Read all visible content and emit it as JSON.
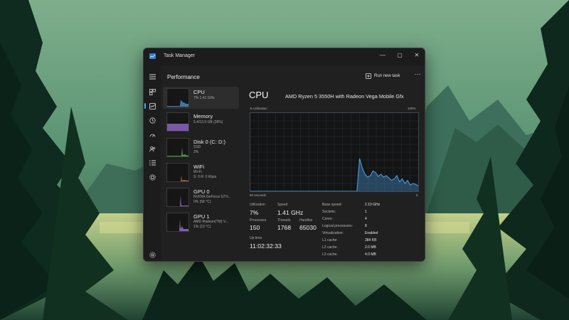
{
  "window": {
    "title": "Task Manager",
    "controls": {
      "minimize": "—",
      "maximize": "▢",
      "close": "✕"
    }
  },
  "nav": {
    "items": [
      {
        "icon": "hamburger-icon"
      },
      {
        "icon": "processes-icon"
      },
      {
        "icon": "performance-icon",
        "active": true
      },
      {
        "icon": "app-history-icon"
      },
      {
        "icon": "startup-apps-icon"
      },
      {
        "icon": "users-icon"
      },
      {
        "icon": "details-icon"
      },
      {
        "icon": "services-icon"
      },
      {
        "icon": "settings-icon"
      }
    ]
  },
  "header": {
    "title": "Performance",
    "run_new_task": "Run new task",
    "more": "···"
  },
  "devices": [
    {
      "name": "CPU",
      "sub1": "7% 1.41 GHz",
      "sub2": "",
      "selected": true,
      "color": "#4ea3e8"
    },
    {
      "name": "Memory",
      "sub1": "5.4/13.9 GB (39%)",
      "sub2": "",
      "selected": false,
      "color": "#9b6fd8"
    },
    {
      "name": "Disk 0 (C: D:)",
      "sub1": "SSD",
      "sub2": "2%",
      "selected": false,
      "color": "#5fbf5f"
    },
    {
      "name": "WiFi",
      "sub1": "Wi-Fi",
      "sub2": "S: 0 R: 0 Kbps",
      "selected": false,
      "color": "#c57b3a"
    },
    {
      "name": "GPU 0",
      "sub1": "NVIDIA GeForce GTX...",
      "sub2": "0% (58 °C)",
      "selected": false,
      "color": "#9b6fd8"
    },
    {
      "name": "GPU 1",
      "sub1": "AMD Radeon(TM) V...",
      "sub2": "1% (19 °C)",
      "selected": false,
      "color": "#9b6fd8"
    }
  ],
  "panel": {
    "title": "CPU",
    "processor": "AMD Ryzen 5 3550H with Radeon Vega Mobile Gfx",
    "graph_label_left": "% Utilization",
    "graph_label_right": "100%",
    "graph_bottom_left": "60 seconds",
    "graph_bottom_right": "0",
    "utilization_history": [
      0,
      0,
      0,
      0,
      0,
      0,
      0,
      0,
      0,
      0,
      0,
      0,
      0,
      0,
      0,
      0,
      0,
      0,
      0,
      0,
      0,
      0,
      0,
      0,
      0,
      0,
      0,
      0,
      0,
      0,
      0,
      0,
      0,
      0,
      0,
      0,
      0,
      0,
      0,
      0,
      0,
      42,
      30,
      22,
      18,
      20,
      26,
      24,
      19,
      22,
      18,
      20,
      17,
      14,
      16,
      20,
      12,
      16,
      10,
      14,
      8,
      10,
      9,
      7
    ]
  },
  "stats": {
    "utilization_label": "Utilization",
    "utilization": "7%",
    "speed_label": "Speed",
    "speed": "1.41 GHz",
    "processes_label": "Processes",
    "processes": "150",
    "threads_label": "Threads",
    "threads": "1768",
    "handles_label": "Handles",
    "handles": "65030",
    "uptime_label": "Up time",
    "uptime": "11:02:32:33"
  },
  "specs": [
    {
      "label": "Base speed:",
      "value": "2.10 GHz"
    },
    {
      "label": "Sockets:",
      "value": "1"
    },
    {
      "label": "Cores:",
      "value": "4"
    },
    {
      "label": "Logical processors:",
      "value": "8"
    },
    {
      "label": "Virtualization:",
      "value": "Enabled"
    },
    {
      "label": "L1 cache:",
      "value": "384 KB"
    },
    {
      "label": "L2 cache:",
      "value": "2.0 MB"
    },
    {
      "label": "L3 cache:",
      "value": "4.0 MB"
    }
  ]
}
